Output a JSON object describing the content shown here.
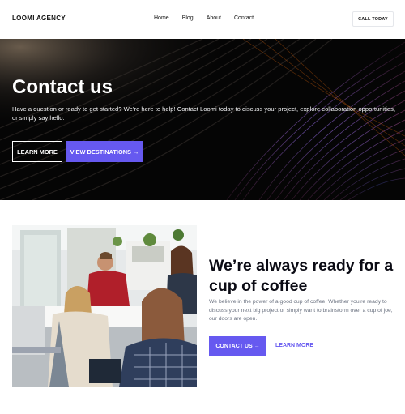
{
  "header": {
    "logo": "LOOMI AGENCY",
    "nav": [
      "Home",
      "Blog",
      "About",
      "Contact"
    ],
    "cta": "CALL TODAY"
  },
  "hero": {
    "title": "Contact us",
    "text": "Have a question or ready to get started? We’re here to help! Contact Loomi today to discuss your project, explore collaboration opportunities, or simply say hello.",
    "btn_learn": "LEARN MORE",
    "btn_destinations": "VIEW DESTINATIONS →"
  },
  "about": {
    "title": "We’re always ready for a cup of coffee",
    "text": "We believe in the power of a good cup of coffee. Whether you’re ready to discuss your next big project or simply want to brainstorm over a cup of joe, our doors are open.",
    "btn_contact": "CONTACT US →",
    "link_learn": "LEARN MORE"
  },
  "colors": {
    "accent": "#6659f0",
    "dark": "#050505"
  },
  "icons": {
    "arrow": "arrow-right-icon"
  }
}
